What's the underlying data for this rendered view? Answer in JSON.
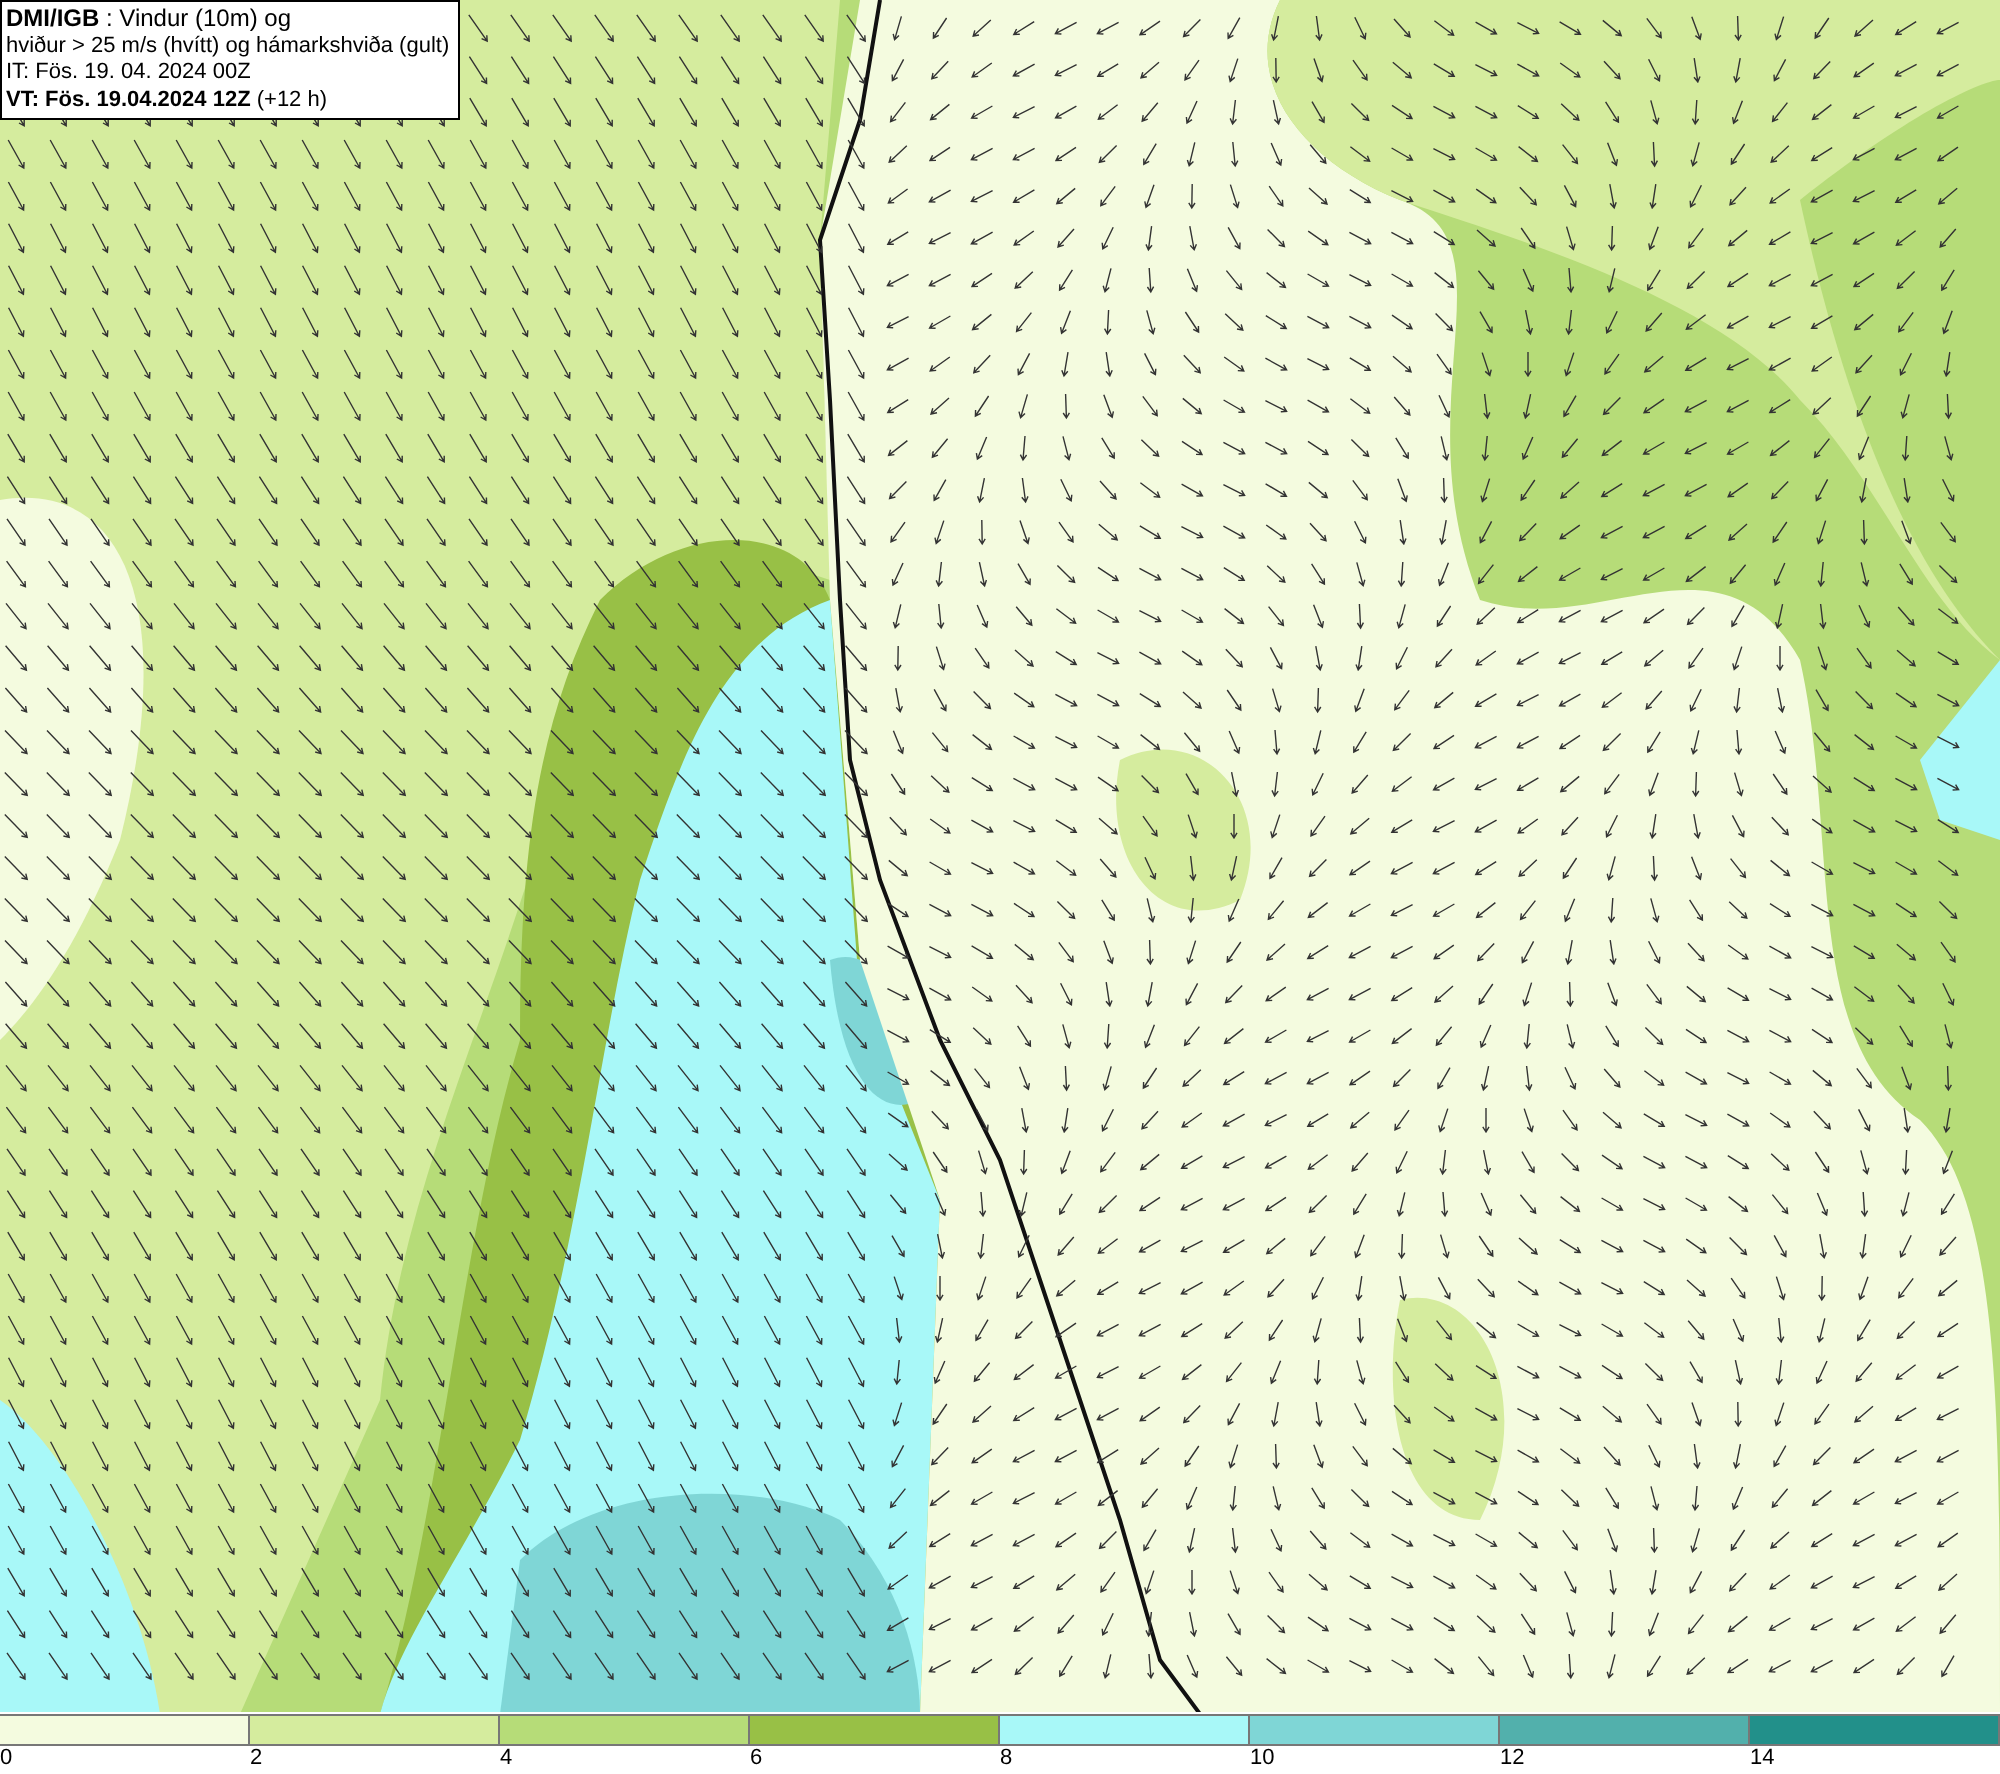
{
  "title_box": {
    "lines": [
      "**DMI/IGB** : Vindur (10m) og",
      "hviður > 25 m/s (hvítt) og hámarkshviða (gult)",
      "IT: Fös. 19. 04. 2024 00Z",
      "**VT: Fös. 19.04.2024 12Z** (+12 h)"
    ]
  },
  "legend": {
    "segments": [
      {
        "label": "0",
        "color": "#f4fbdf"
      },
      {
        "label": "2",
        "color": "#d5ec9e"
      },
      {
        "label": "4",
        "color": "#b6dc78"
      },
      {
        "label": "6",
        "color": "#98c046"
      },
      {
        "label": "8",
        "color": "#a8f8f8"
      },
      {
        "label": "10",
        "color": "#7fd6d6"
      },
      {
        "label": "12",
        "color": "#52b0ac"
      },
      {
        "label": "14",
        "color": "#22908a"
      }
    ]
  }
}
